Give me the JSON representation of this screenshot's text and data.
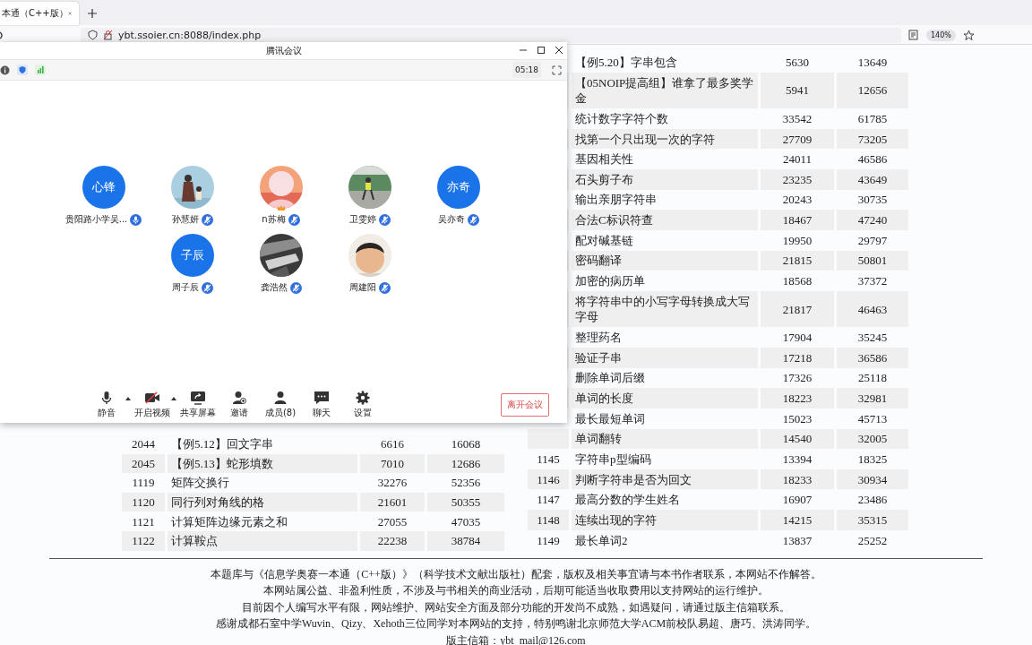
{
  "browser": {
    "tabs": [
      {
        "title": "本通（C++版）",
        "selected": true
      }
    ],
    "address": "ybt.ssoier.cn:8088/index.php",
    "zoom": "140%"
  },
  "table_left": {
    "rows": [
      {
        "column_1": "2044",
        "column_2": "【例5.12】回文字串",
        "column_3": "6616",
        "column_4": "16068"
      },
      {
        "column_1": "2045",
        "column_2": "【例5.13】蛇形填数",
        "column_3": "7010",
        "column_4": "12686"
      },
      {
        "column_1": "1119",
        "column_2": "矩阵交换行",
        "column_3": "32276",
        "column_4": "52356"
      },
      {
        "column_1": "1120",
        "column_2": "同行列对角线的格",
        "column_3": "21601",
        "column_4": "50355"
      },
      {
        "column_1": "1121",
        "column_2": "计算矩阵边缘元素之和",
        "column_3": "27055",
        "column_4": "47035"
      },
      {
        "column_1": "1122",
        "column_2": "计算鞍点",
        "column_3": "22238",
        "column_4": "38784"
      }
    ]
  },
  "table_right": {
    "rows": [
      {
        "column_2": "【例5.20】字串包含",
        "column_3": "5630",
        "column_4": "13649"
      },
      {
        "column_2": "【05NOIP提高组】谁拿了最多奖学金",
        "column_3": "5941",
        "column_4": "12656"
      },
      {
        "column_2": "统计数字字符个数",
        "column_3": "33542",
        "column_4": "61785"
      },
      {
        "column_2": "找第一个只出现一次的字符",
        "column_3": "27709",
        "column_4": "73205"
      },
      {
        "column_2": "基因相关性",
        "column_3": "24011",
        "column_4": "46586"
      },
      {
        "column_2": "石头剪子布",
        "column_3": "23235",
        "column_4": "43649"
      },
      {
        "column_2": "输出亲朋字符串",
        "column_3": "20243",
        "column_4": "30735"
      },
      {
        "column_2": "合法C标识符查",
        "column_3": "18467",
        "column_4": "47240"
      },
      {
        "column_2": "配对碱基链",
        "column_3": "19950",
        "column_4": "29797"
      },
      {
        "column_2": "密码翻译",
        "column_3": "21815",
        "column_4": "50801"
      },
      {
        "column_2": "加密的病历单",
        "column_3": "18568",
        "column_4": "37372"
      },
      {
        "column_2": "将字符串中的小写字母转换成大写字母",
        "column_3": "21817",
        "column_4": "46463"
      },
      {
        "column_2": "整理药名",
        "column_3": "17904",
        "column_4": "35245"
      },
      {
        "column_2": "验证子串",
        "column_3": "17218",
        "column_4": "36586"
      },
      {
        "column_2": "删除单词后缀",
        "column_3": "17326",
        "column_4": "25118"
      },
      {
        "column_2": "单词的长度",
        "column_3": "18223",
        "column_4": "32981"
      },
      {
        "column_2": "最长最短单词",
        "column_3": "15023",
        "column_4": "45713"
      },
      {
        "column_2": "单词翻转",
        "column_3": "14540",
        "column_4": "32005"
      },
      {
        "column_1": "1145",
        "column_2": "字符串p型编码",
        "column_3": "13394",
        "column_4": "18325"
      },
      {
        "column_1": "1146",
        "column_2": "判断字符串是否为回文",
        "column_3": "18233",
        "column_4": "30934"
      },
      {
        "column_1": "1147",
        "column_2": "最高分数的学生姓名",
        "column_3": "16907",
        "column_4": "23486"
      },
      {
        "column_1": "1148",
        "column_2": "连续出现的字符",
        "column_3": "14215",
        "column_4": "35315"
      },
      {
        "column_1": "1149",
        "column_2": "最长单词2",
        "column_3": "13837",
        "column_4": "25252"
      }
    ]
  },
  "footer": {
    "lines": [
      "本题库与《信息学奥赛一本通（C++版）》（科学技术文献出版社）配套，版权及相关事宜请与本书作者联系，本网站不作解答。",
      "本网站属公益、非盈利性质，不涉及与书相关的商业活动，后期可能适当收取费用以支持网站的运行维护。",
      "目前因个人编写水平有限，网站维护、网站安全方面及部分功能的开发尚不成熟，如遇疑问，请通过版主信箱联系。",
      "感谢成都石室中学Wuvin、Qizy、Xehoth三位同学对本网站的支持，特别鸣谢北京师范大学ACM前校队易超、唐巧、洪涛同学。",
      "版主信箱：ybt_mail@126.com"
    ]
  },
  "meeting": {
    "title": "腾讯会议",
    "timer": "05:18",
    "participants": [
      {
        "name": "贵阳路小学吴...",
        "kind": "initials",
        "initials": "心锋",
        "muted": false,
        "host": false
      },
      {
        "name": "孙慧妍",
        "kind": "picture",
        "muted": true,
        "host": false
      },
      {
        "name": "n苏梅",
        "kind": "picture",
        "muted": true,
        "host": true
      },
      {
        "name": "卫雯婷",
        "kind": "picture",
        "muted": true,
        "host": false
      },
      {
        "name": "吴亦奇",
        "kind": "initials",
        "initials": "亦奇",
        "muted": true,
        "host": false
      },
      {
        "name": "周子辰",
        "kind": "initials",
        "initials": "子辰",
        "muted": true,
        "host": false
      },
      {
        "name": "龚浩然",
        "kind": "picture",
        "muted": true,
        "host": false
      },
      {
        "name": "周建阳",
        "kind": "picture",
        "muted": true,
        "host": false
      }
    ],
    "toolbar": [
      {
        "label": "静音",
        "kind": "mic",
        "menu": true
      },
      {
        "label": "开启视频",
        "kind": "video-off",
        "menu": true
      },
      {
        "label": "共享屏幕",
        "kind": "share",
        "menu": false
      },
      {
        "label": "邀请",
        "kind": "invite",
        "menu": false
      },
      {
        "label": "成员(8)",
        "kind": "members",
        "menu": false
      },
      {
        "label": "聊天",
        "kind": "chat",
        "menu": false
      },
      {
        "label": "设置",
        "kind": "settings",
        "menu": false
      }
    ],
    "leave_button": "离开会议"
  }
}
